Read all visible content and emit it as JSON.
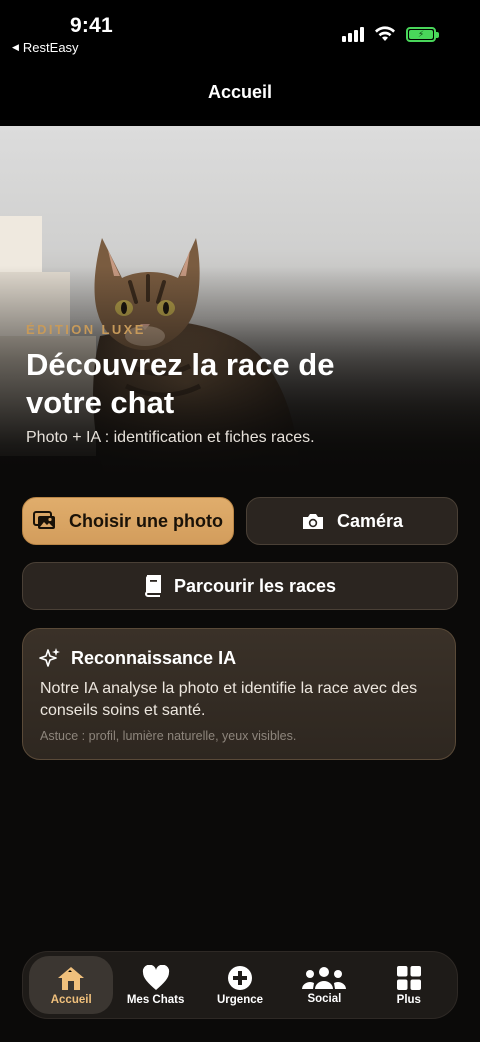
{
  "status_bar": {
    "time": "9:41",
    "back_app": "RestEasy",
    "signal_icon": "cellular-signal-icon",
    "wifi_icon": "wifi-icon",
    "battery_icon": "battery-charging-icon",
    "battery_color": "#49d65a"
  },
  "nav": {
    "title": "Accueil"
  },
  "hero": {
    "eyebrow": "ÉDITION LUXE",
    "title": "Découvrez la race de votre chat",
    "subtitle": "Photo + IA : identification et fiches races.",
    "image": "cat-photo"
  },
  "actions": {
    "choose_photo": "Choisir une photo",
    "choose_photo_icon": "photos-icon",
    "camera": "Caméra",
    "camera_icon": "camera-icon",
    "browse_breeds": "Parcourir les races",
    "browse_breeds_icon": "book-icon"
  },
  "ai_card": {
    "icon": "sparkles-icon",
    "title": "Reconnaissance IA",
    "body": "Notre IA analyse la photo et identifie la race avec des conseils soins et santé.",
    "tip": "Astuce : profil, lumière naturelle, yeux visibles."
  },
  "tab_bar": {
    "items": [
      {
        "label": "Accueil",
        "icon": "home-icon",
        "active": true
      },
      {
        "label": "Mes Chats",
        "icon": "heart-icon",
        "active": false
      },
      {
        "label": "Urgence",
        "icon": "plus-circle-icon",
        "active": false
      },
      {
        "label": "Social",
        "icon": "people-icon",
        "active": false
      },
      {
        "label": "Plus",
        "icon": "grid-icon",
        "active": false
      }
    ]
  },
  "colors": {
    "accent": "#d9a566",
    "background": "#0b0a09",
    "active_tab_label": "#f0c07c"
  }
}
